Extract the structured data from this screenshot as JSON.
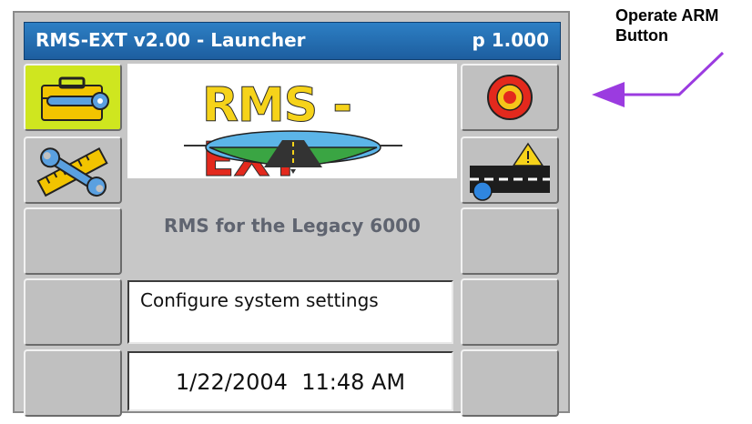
{
  "window": {
    "title": "RMS-EXT v2.00 - Launcher",
    "page_indicator": "p 1.000"
  },
  "logo": {
    "part1": "RMS",
    "dash": " - ",
    "part2": "EXT"
  },
  "subtitle": "RMS for the Legacy 6000",
  "status_message": "Configure system settings",
  "datetime": "1/22/2004  11:48 AM",
  "annotation": {
    "line1": "Operate ARM",
    "line2": "Button"
  },
  "colors": {
    "titlebar": "#1d5e9f",
    "active_key": "#cfe61f",
    "arrow": "#9b3be0",
    "arm_button_red": "#e3291d",
    "arm_button_yellow": "#f6c51a"
  },
  "softkeys": {
    "left": [
      "settings-toolbox-icon",
      "tools-ruler-icon",
      "",
      "",
      ""
    ],
    "right": [
      "arm-target-icon",
      "road-warning-icon",
      "",
      "",
      ""
    ]
  }
}
